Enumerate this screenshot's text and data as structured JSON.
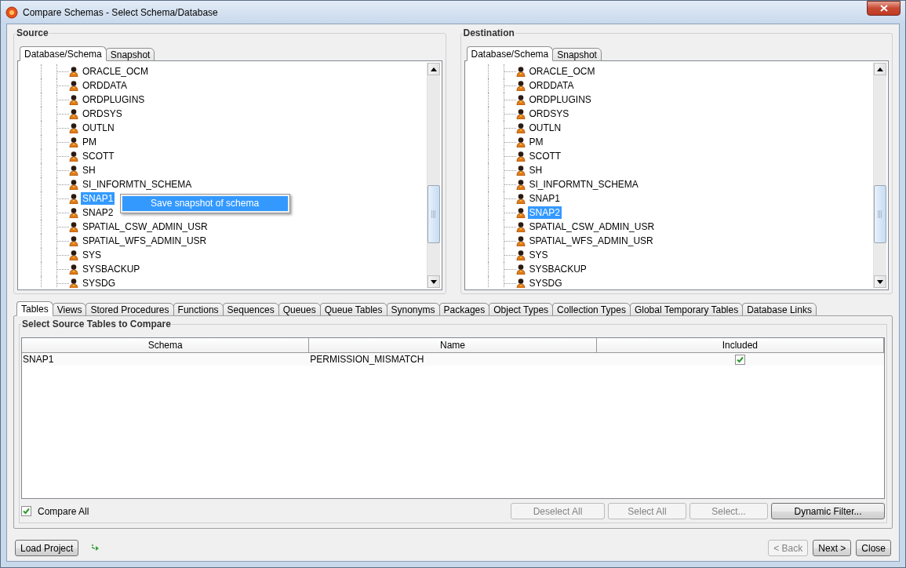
{
  "window": {
    "title": "Compare Schemas - Select Schema/Database"
  },
  "panels": [
    {
      "label": "Source",
      "tabs": [
        {
          "label": "Database/Schema",
          "selected": true
        },
        {
          "label": "Snapshot",
          "selected": false
        }
      ],
      "schemas": [
        {
          "name": "ORACLE_OCM",
          "selected": false
        },
        {
          "name": "ORDDATA",
          "selected": false
        },
        {
          "name": "ORDPLUGINS",
          "selected": false
        },
        {
          "name": "ORDSYS",
          "selected": false
        },
        {
          "name": "OUTLN",
          "selected": false
        },
        {
          "name": "PM",
          "selected": false
        },
        {
          "name": "SCOTT",
          "selected": false
        },
        {
          "name": "SH",
          "selected": false
        },
        {
          "name": "SI_INFORMTN_SCHEMA",
          "selected": false
        },
        {
          "name": "SNAP1",
          "selected": true
        },
        {
          "name": "SNAP2",
          "selected": false
        },
        {
          "name": "SPATIAL_CSW_ADMIN_USR",
          "selected": false
        },
        {
          "name": "SPATIAL_WFS_ADMIN_USR",
          "selected": false
        },
        {
          "name": "SYS",
          "selected": false
        },
        {
          "name": "SYSBACKUP",
          "selected": false
        },
        {
          "name": "SYSDG",
          "selected": false
        }
      ],
      "context_menu": {
        "items": [
          {
            "label": "Save snapshot of schema",
            "selected": true
          }
        ]
      }
    },
    {
      "label": "Destination",
      "tabs": [
        {
          "label": "Database/Schema",
          "selected": true
        },
        {
          "label": "Snapshot",
          "selected": false
        }
      ],
      "schemas": [
        {
          "name": "ORACLE_OCM",
          "selected": false
        },
        {
          "name": "ORDDATA",
          "selected": false
        },
        {
          "name": "ORDPLUGINS",
          "selected": false
        },
        {
          "name": "ORDSYS",
          "selected": false
        },
        {
          "name": "OUTLN",
          "selected": false
        },
        {
          "name": "PM",
          "selected": false
        },
        {
          "name": "SCOTT",
          "selected": false
        },
        {
          "name": "SH",
          "selected": false
        },
        {
          "name": "SI_INFORMTN_SCHEMA",
          "selected": false
        },
        {
          "name": "SNAP1",
          "selected": false
        },
        {
          "name": "SNAP2",
          "selected": true
        },
        {
          "name": "SPATIAL_CSW_ADMIN_USR",
          "selected": false
        },
        {
          "name": "SPATIAL_WFS_ADMIN_USR",
          "selected": false
        },
        {
          "name": "SYS",
          "selected": false
        },
        {
          "name": "SYSBACKUP",
          "selected": false
        },
        {
          "name": "SYSDG",
          "selected": false
        }
      ]
    }
  ],
  "object_tabs": [
    {
      "label": "Tables",
      "selected": true
    },
    {
      "label": "Views",
      "selected": false
    },
    {
      "label": "Stored Procedures",
      "selected": false
    },
    {
      "label": "Functions",
      "selected": false
    },
    {
      "label": "Sequences",
      "selected": false
    },
    {
      "label": "Queues",
      "selected": false
    },
    {
      "label": "Queue Tables",
      "selected": false
    },
    {
      "label": "Synonyms",
      "selected": false
    },
    {
      "label": "Packages",
      "selected": false
    },
    {
      "label": "Object Types",
      "selected": false
    },
    {
      "label": "Collection Types",
      "selected": false
    },
    {
      "label": "Global Temporary Tables",
      "selected": false
    },
    {
      "label": "Database Links",
      "selected": false
    }
  ],
  "group": {
    "label": "Select Source Tables to Compare",
    "columns": [
      "Schema",
      "Name",
      "Included"
    ],
    "rows": [
      {
        "schema": "SNAP1",
        "name": "PERMISSION_MISMATCH",
        "included": true
      }
    ]
  },
  "compare_all": {
    "label": "Compare All",
    "checked": true
  },
  "action_buttons": [
    {
      "label": "Deselect All",
      "disabled": true
    },
    {
      "label": "Select All",
      "disabled": true
    },
    {
      "label": "Select...",
      "disabled": true
    },
    {
      "label": "Dynamic Filter...",
      "disabled": false
    }
  ],
  "footer": {
    "left_buttons": [
      {
        "label": "Load Project",
        "disabled": false
      }
    ],
    "right_buttons": [
      {
        "label": "< Back",
        "disabled": true
      },
      {
        "label": "Next >",
        "disabled": false
      },
      {
        "label": "Close",
        "disabled": false
      }
    ]
  }
}
